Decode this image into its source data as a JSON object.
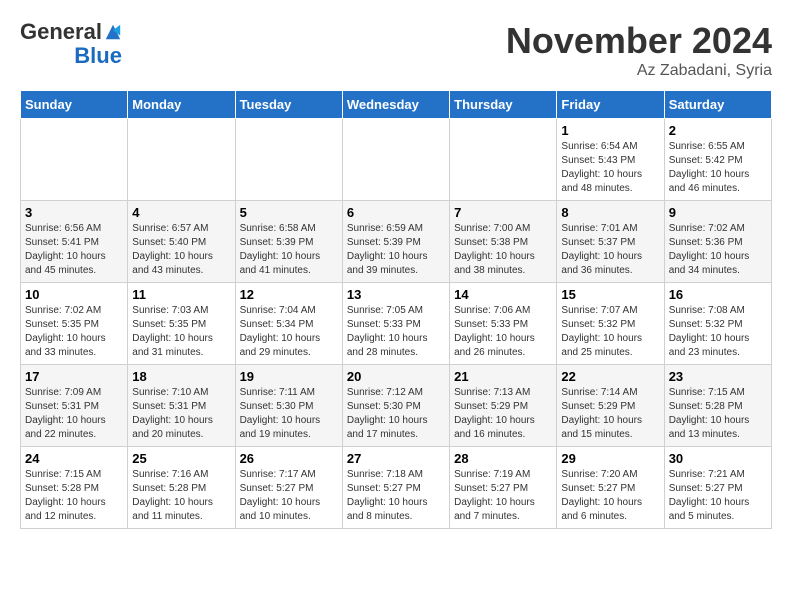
{
  "header": {
    "logo_general": "General",
    "logo_blue": "Blue",
    "month_title": "November 2024",
    "location": "Az Zabadani, Syria"
  },
  "weekdays": [
    "Sunday",
    "Monday",
    "Tuesday",
    "Wednesday",
    "Thursday",
    "Friday",
    "Saturday"
  ],
  "weeks": [
    [
      {
        "day": "",
        "info": ""
      },
      {
        "day": "",
        "info": ""
      },
      {
        "day": "",
        "info": ""
      },
      {
        "day": "",
        "info": ""
      },
      {
        "day": "",
        "info": ""
      },
      {
        "day": "1",
        "info": "Sunrise: 6:54 AM\nSunset: 5:43 PM\nDaylight: 10 hours and 48 minutes."
      },
      {
        "day": "2",
        "info": "Sunrise: 6:55 AM\nSunset: 5:42 PM\nDaylight: 10 hours and 46 minutes."
      }
    ],
    [
      {
        "day": "3",
        "info": "Sunrise: 6:56 AM\nSunset: 5:41 PM\nDaylight: 10 hours and 45 minutes."
      },
      {
        "day": "4",
        "info": "Sunrise: 6:57 AM\nSunset: 5:40 PM\nDaylight: 10 hours and 43 minutes."
      },
      {
        "day": "5",
        "info": "Sunrise: 6:58 AM\nSunset: 5:39 PM\nDaylight: 10 hours and 41 minutes."
      },
      {
        "day": "6",
        "info": "Sunrise: 6:59 AM\nSunset: 5:39 PM\nDaylight: 10 hours and 39 minutes."
      },
      {
        "day": "7",
        "info": "Sunrise: 7:00 AM\nSunset: 5:38 PM\nDaylight: 10 hours and 38 minutes."
      },
      {
        "day": "8",
        "info": "Sunrise: 7:01 AM\nSunset: 5:37 PM\nDaylight: 10 hours and 36 minutes."
      },
      {
        "day": "9",
        "info": "Sunrise: 7:02 AM\nSunset: 5:36 PM\nDaylight: 10 hours and 34 minutes."
      }
    ],
    [
      {
        "day": "10",
        "info": "Sunrise: 7:02 AM\nSunset: 5:35 PM\nDaylight: 10 hours and 33 minutes."
      },
      {
        "day": "11",
        "info": "Sunrise: 7:03 AM\nSunset: 5:35 PM\nDaylight: 10 hours and 31 minutes."
      },
      {
        "day": "12",
        "info": "Sunrise: 7:04 AM\nSunset: 5:34 PM\nDaylight: 10 hours and 29 minutes."
      },
      {
        "day": "13",
        "info": "Sunrise: 7:05 AM\nSunset: 5:33 PM\nDaylight: 10 hours and 28 minutes."
      },
      {
        "day": "14",
        "info": "Sunrise: 7:06 AM\nSunset: 5:33 PM\nDaylight: 10 hours and 26 minutes."
      },
      {
        "day": "15",
        "info": "Sunrise: 7:07 AM\nSunset: 5:32 PM\nDaylight: 10 hours and 25 minutes."
      },
      {
        "day": "16",
        "info": "Sunrise: 7:08 AM\nSunset: 5:32 PM\nDaylight: 10 hours and 23 minutes."
      }
    ],
    [
      {
        "day": "17",
        "info": "Sunrise: 7:09 AM\nSunset: 5:31 PM\nDaylight: 10 hours and 22 minutes."
      },
      {
        "day": "18",
        "info": "Sunrise: 7:10 AM\nSunset: 5:31 PM\nDaylight: 10 hours and 20 minutes."
      },
      {
        "day": "19",
        "info": "Sunrise: 7:11 AM\nSunset: 5:30 PM\nDaylight: 10 hours and 19 minutes."
      },
      {
        "day": "20",
        "info": "Sunrise: 7:12 AM\nSunset: 5:30 PM\nDaylight: 10 hours and 17 minutes."
      },
      {
        "day": "21",
        "info": "Sunrise: 7:13 AM\nSunset: 5:29 PM\nDaylight: 10 hours and 16 minutes."
      },
      {
        "day": "22",
        "info": "Sunrise: 7:14 AM\nSunset: 5:29 PM\nDaylight: 10 hours and 15 minutes."
      },
      {
        "day": "23",
        "info": "Sunrise: 7:15 AM\nSunset: 5:28 PM\nDaylight: 10 hours and 13 minutes."
      }
    ],
    [
      {
        "day": "24",
        "info": "Sunrise: 7:15 AM\nSunset: 5:28 PM\nDaylight: 10 hours and 12 minutes."
      },
      {
        "day": "25",
        "info": "Sunrise: 7:16 AM\nSunset: 5:28 PM\nDaylight: 10 hours and 11 minutes."
      },
      {
        "day": "26",
        "info": "Sunrise: 7:17 AM\nSunset: 5:27 PM\nDaylight: 10 hours and 10 minutes."
      },
      {
        "day": "27",
        "info": "Sunrise: 7:18 AM\nSunset: 5:27 PM\nDaylight: 10 hours and 8 minutes."
      },
      {
        "day": "28",
        "info": "Sunrise: 7:19 AM\nSunset: 5:27 PM\nDaylight: 10 hours and 7 minutes."
      },
      {
        "day": "29",
        "info": "Sunrise: 7:20 AM\nSunset: 5:27 PM\nDaylight: 10 hours and 6 minutes."
      },
      {
        "day": "30",
        "info": "Sunrise: 7:21 AM\nSunset: 5:27 PM\nDaylight: 10 hours and 5 minutes."
      }
    ]
  ]
}
